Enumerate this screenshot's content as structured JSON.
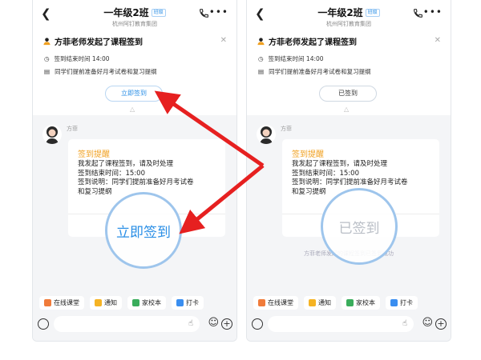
{
  "colors": {
    "accent": "#2b8fe6",
    "warning": "#f0a020",
    "arrow": "#e62020"
  },
  "header": {
    "title": "一年级2班",
    "tag": "班级",
    "subtitle": "杭州阿钉教育集团",
    "back_icon": "chevron-left-icon",
    "call_icon": "phone-icon",
    "more_icon": "more-dots-icon"
  },
  "notice": {
    "title": "方菲老师发起了课程签到",
    "time": "签到结束时间 14:00",
    "desc": "同学们提前准备好月考试卷和复习提纲"
  },
  "screens": {
    "before": {
      "button_label": "立即签到",
      "magnifier_label": "立即签到"
    },
    "after": {
      "button_label": "已签到",
      "magnifier_label": "已签到"
    }
  },
  "message": {
    "sender": "方菲",
    "card_title": "签到提醒",
    "lines": [
      "我发起了课程签到，请及时处理",
      "签到结束时间：15:00",
      "签到说明：同学们提前准备好月考试卷",
      "和复习提纲"
    ],
    "system_notice": "方菲老师发起的课程签到已签到成功"
  },
  "quickbar": [
    {
      "label": "在线课堂",
      "icon": "online-class-icon",
      "color": "#f07b3a"
    },
    {
      "label": "通知",
      "icon": "megaphone-icon",
      "color": "#f5b324"
    },
    {
      "label": "家校本",
      "icon": "notebook-icon",
      "color": "#3aad5c"
    },
    {
      "label": "打卡",
      "icon": "checkin-icon",
      "color": "#3a8ef0"
    }
  ]
}
